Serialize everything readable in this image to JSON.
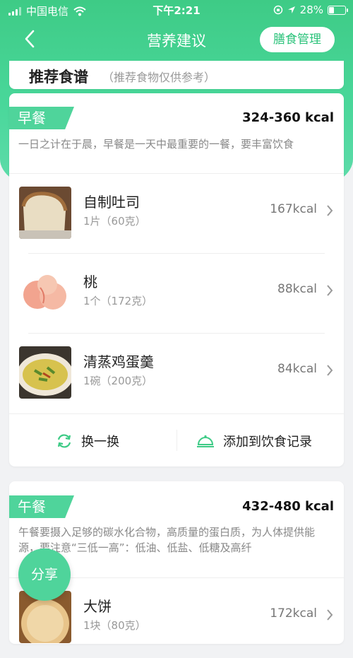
{
  "status_bar": {
    "carrier": "中国电信",
    "time": "下午2:21",
    "battery": "28%",
    "battery_level": 0.28
  },
  "nav": {
    "title": "营养建议",
    "action_label": "膳食管理"
  },
  "recipes": {
    "title": "推荐食谱",
    "note": "（推荐食物仅供参考）"
  },
  "breakfast": {
    "tag": "早餐",
    "kcal": "324-360 kcal",
    "desc": "一日之计在于晨，早餐是一天中最重要的一餐，要丰富饮食",
    "foods": [
      {
        "name": "自制吐司",
        "amount": "1片（60克）",
        "kcal": "167kcal"
      },
      {
        "name": "桃",
        "amount": "1个（172克）",
        "kcal": "88kcal"
      },
      {
        "name": "清蒸鸡蛋羹",
        "amount": "1碗（200克）",
        "kcal": "84kcal"
      }
    ],
    "actions": {
      "swap": "换一换",
      "add": "添加到饮食记录"
    }
  },
  "lunch": {
    "tag": "午餐",
    "kcal": "432-480 kcal",
    "desc": "午餐要摄入足够的碳水化合物，高质量的蛋白质，为人体提供能源，要注意“三低一高”：低油、低盐、低糖及高纤",
    "foods": [
      {
        "name": "大饼",
        "amount": "1块（80克）",
        "kcal": "172kcal"
      }
    ]
  },
  "share_label": "分享",
  "colors": {
    "accent": "#4fd49b",
    "header_gradient_top": "#3ecb86",
    "background": "#f1f2f4"
  }
}
